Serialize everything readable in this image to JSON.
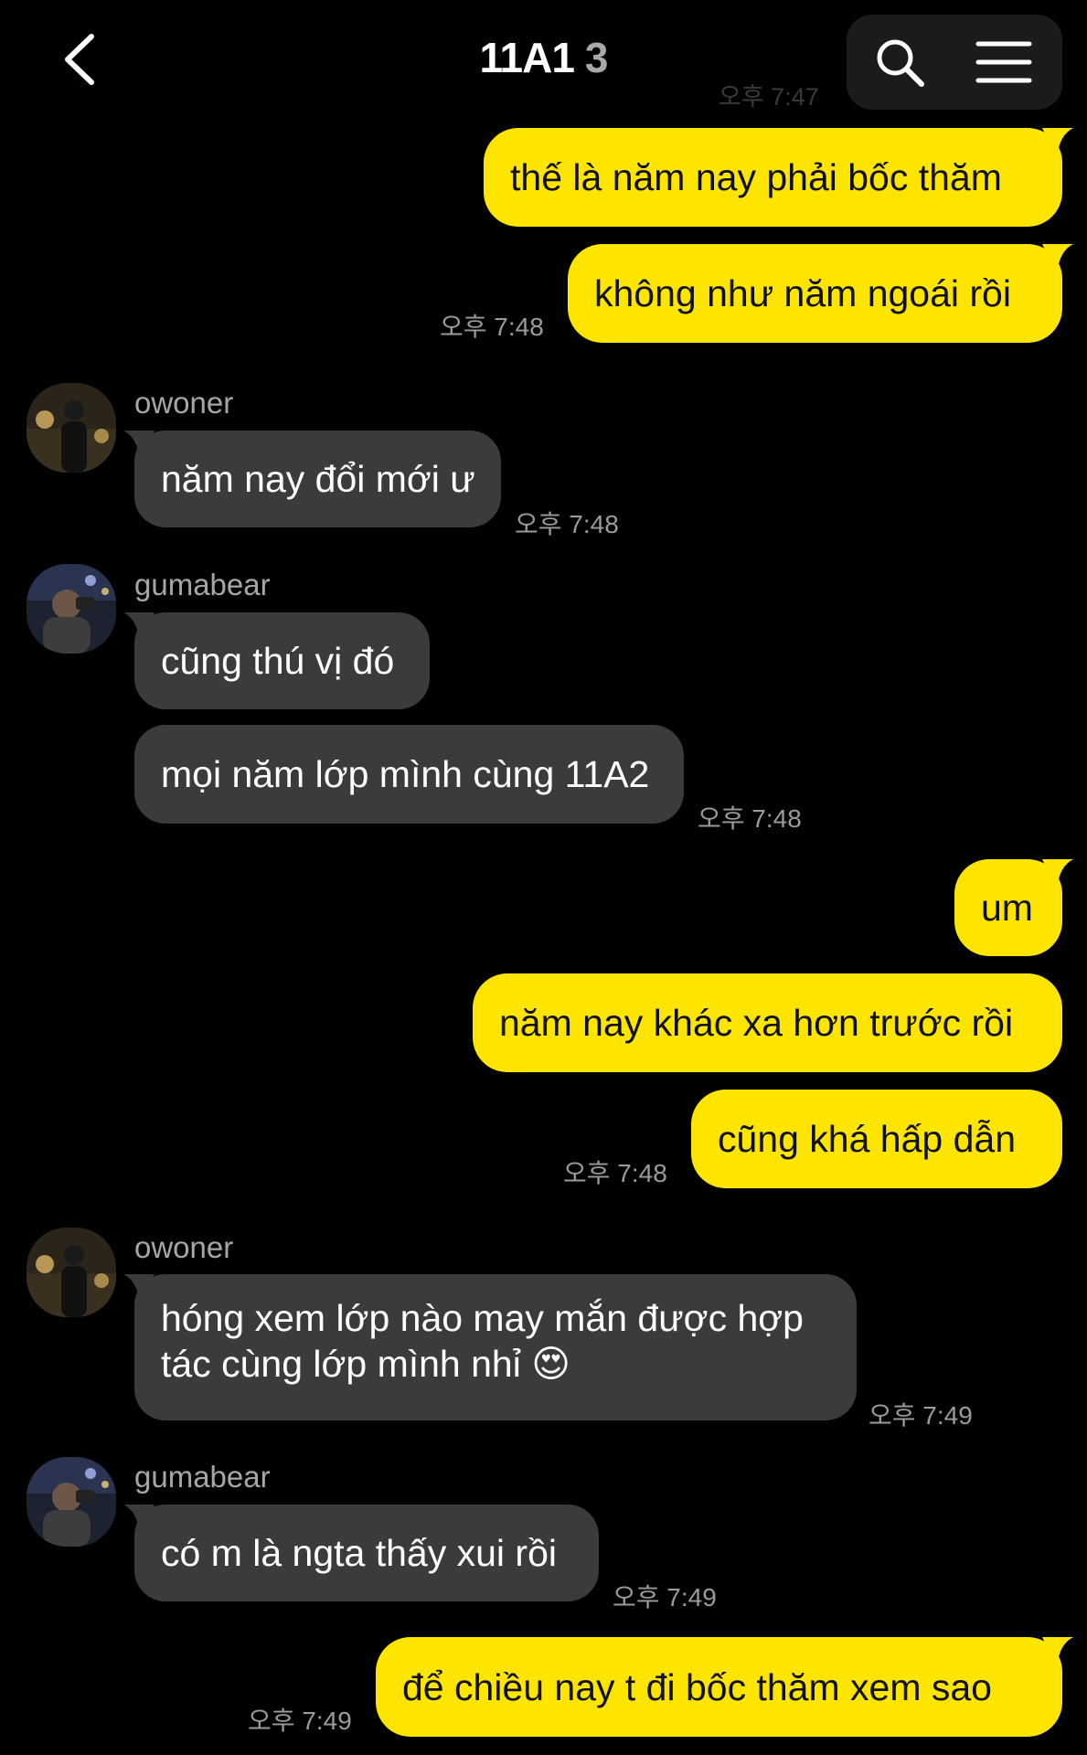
{
  "header": {
    "title": "11A1",
    "member_count": "3"
  },
  "ghost": {
    "time": "오후 7:47"
  },
  "messages": [
    {
      "text": "thế là năm nay phải bốc thăm"
    },
    {
      "text": "không như năm ngoái rồi",
      "time": "오후 7:48"
    },
    {
      "sender": "owoner",
      "text": "năm nay đổi mới ư",
      "time": "오후 7:48"
    },
    {
      "sender": "gumabear",
      "text": "cũng thú vị đó"
    },
    {
      "text": "mọi năm lớp mình cùng 11A2",
      "time": "오후 7:48"
    },
    {
      "text": "um"
    },
    {
      "text": "năm nay khác xa hơn trước rồi"
    },
    {
      "text": "cũng khá hấp dẫn",
      "time": "오후 7:48"
    },
    {
      "sender": "owoner",
      "text": "hóng xem lớp nào may mắn được hợp tác cùng lớp mình nhỉ 😍",
      "time": "오후 7:49"
    },
    {
      "sender": "gumabear",
      "text": "có m là ngta thấy xui rồi",
      "time": "오후 7:49"
    },
    {
      "text": "để chiều nay t đi bốc thăm xem sao",
      "time": "오후 7:49"
    }
  ],
  "colors": {
    "outgoing": "#fee500",
    "incoming": "#3b3b3e",
    "background": "#000000"
  },
  "icons": [
    "back-chevron-icon",
    "search-icon",
    "menu-icon"
  ]
}
